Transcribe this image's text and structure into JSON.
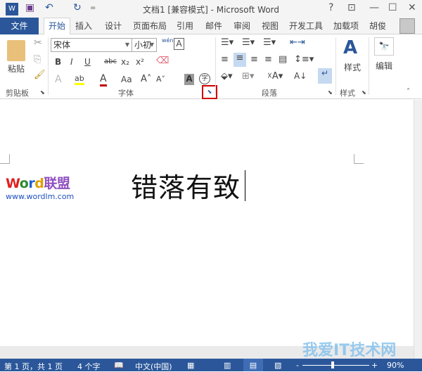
{
  "titlebar": {
    "title": "文档1 [兼容模式] - Microsoft Word",
    "help": "?",
    "ribbon_display": "⊡",
    "minimize": "—",
    "maximize": "☐",
    "close": "✕",
    "undo": "↶",
    "redo": "↻",
    "customize": "="
  },
  "tabs": {
    "file": "文件",
    "items": [
      "开始",
      "插入",
      "设计",
      "页面布局",
      "引用",
      "邮件",
      "审阅",
      "视图",
      "开发工具",
      "加载项"
    ],
    "user": "胡俊"
  },
  "ribbon": {
    "clipboard": {
      "label": "剪贴板",
      "paste": "粘贴"
    },
    "font": {
      "label": "字体",
      "font_name": "宋体",
      "font_size": "小初",
      "bold": "B",
      "italic": "I",
      "underline": "U",
      "strike": "abc",
      "sub": "x₂",
      "sup": "x²",
      "change_case": "Aa",
      "grow": "A˄",
      "shrink": "A˅",
      "char_shade": "A",
      "enclose": "字",
      "phonetic": "wén",
      "border": "A",
      "effects": "A",
      "highlight": "ab",
      "font_color": "A"
    },
    "paragraph": {
      "label": "段落"
    },
    "styles": {
      "label": "样式",
      "button": "样式"
    },
    "editing": {
      "button": "编辑"
    }
  },
  "document": {
    "text": "错落有致",
    "watermark_logo": "Word联盟 www.wordlm.com"
  },
  "statusbar": {
    "page": "第 1 页，共 1 页",
    "words": "4 个字",
    "language": "中文(中国)",
    "zoom_minus": "-",
    "zoom_plus": "+",
    "zoom": "90%",
    "zoom_value": 90
  },
  "site_watermark": "我爱IT技术网"
}
